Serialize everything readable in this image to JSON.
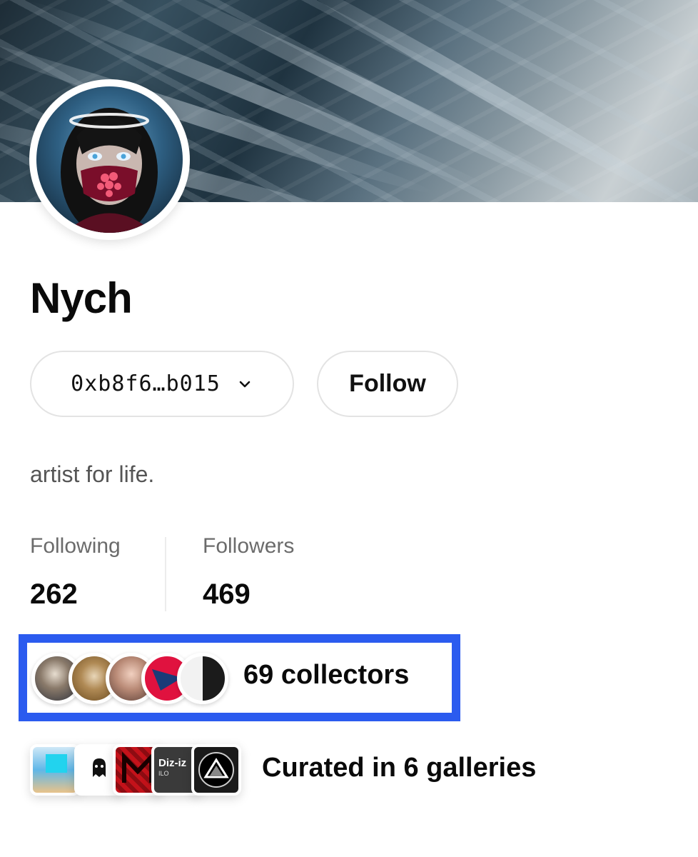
{
  "profile": {
    "name": "Nych",
    "wallet": "0xb8f6…b015",
    "follow_label": "Follow",
    "bio": "artist for life."
  },
  "stats": {
    "following_label": "Following",
    "following_value": "262",
    "followers_label": "Followers",
    "followers_value": "469"
  },
  "collectors": {
    "text": "69 collectors"
  },
  "galleries": {
    "text": "Curated in 6 galleries",
    "thumb_texts": [
      "Diz-iz",
      "ILO"
    ]
  },
  "icons": {
    "wallet_dropdown": "chevron-down-icon"
  },
  "colors": {
    "highlight": "#2b5bef",
    "pill_border": "#e3e3e3",
    "secondary_text": "#6b6b6b"
  }
}
